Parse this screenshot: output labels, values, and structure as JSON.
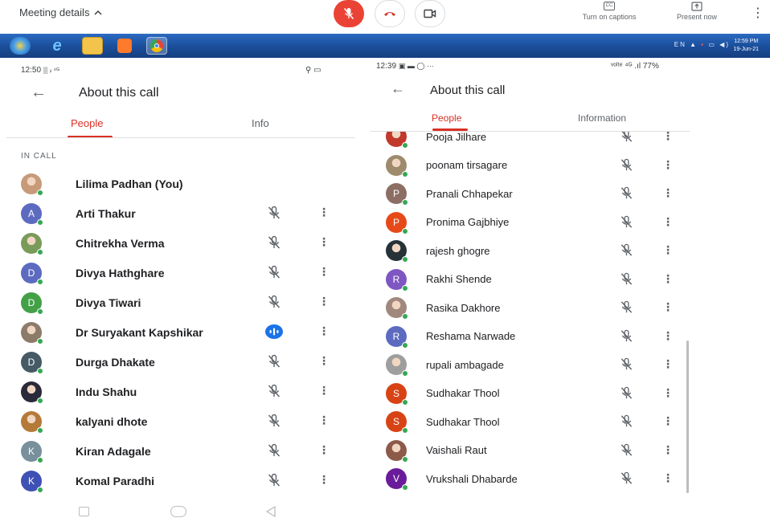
{
  "meet_bar": {
    "meeting_details": "Meeting details",
    "captions_label": "Turn on captions",
    "present_label": "Present now",
    "captions_icon_text": "CC"
  },
  "taskbar": {
    "lang": "EN",
    "time": "12:59 PM",
    "date": "19-Jun-21"
  },
  "left": {
    "status_time": "12:50",
    "status_icons": "▒ ᵢₗ ⁴ᴳ",
    "status_right": "⚲ ▭",
    "title": "About this call",
    "tabs": [
      "People",
      "Info"
    ],
    "section": "IN CALL",
    "people": [
      {
        "name": "Lilima Padhan (You)",
        "avatar": "photo",
        "color": "#c79a7a",
        "initial": "",
        "action": "none"
      },
      {
        "name": "Arti Thakur",
        "avatar": "letter",
        "color": "#5c6bc0",
        "initial": "A",
        "action": "muted"
      },
      {
        "name": "Chitrekha Verma",
        "avatar": "photo",
        "color": "#7a9a5a",
        "initial": "",
        "action": "muted"
      },
      {
        "name": "Divya Hathghare",
        "avatar": "letter",
        "color": "#5c6bc0",
        "initial": "D",
        "action": "muted"
      },
      {
        "name": "Divya Tiwari",
        "avatar": "letter",
        "color": "#43a047",
        "initial": "D",
        "action": "muted"
      },
      {
        "name": "Dr Suryakant Kapshikar",
        "avatar": "photo",
        "color": "#8d7b6a",
        "initial": "",
        "action": "speaking"
      },
      {
        "name": "Durga Dhakate",
        "avatar": "letter",
        "color": "#455a64",
        "initial": "D",
        "action": "muted"
      },
      {
        "name": "Indu Shahu",
        "avatar": "photo",
        "color": "#2a2a3a",
        "initial": "",
        "action": "muted"
      },
      {
        "name": "kalyani dhote",
        "avatar": "photo",
        "color": "#b57a3a",
        "initial": "",
        "action": "muted"
      },
      {
        "name": "Kiran Adagale",
        "avatar": "letter",
        "color": "#78909c",
        "initial": "K",
        "action": "muted"
      },
      {
        "name": "Komal Paradhi",
        "avatar": "letter",
        "color": "#3f51b5",
        "initial": "K",
        "action": "muted"
      }
    ]
  },
  "right": {
    "status_time": "12:39",
    "status_icons": "▣ ▬ ◯ ···",
    "status_right": "ᵛᵒˡᵗᵉ ⁴ᴳ .ıl 77%",
    "title": "About this call",
    "tabs": [
      "People",
      "Information"
    ],
    "people": [
      {
        "name": "Pooja Jilhare",
        "avatar": "photo",
        "color": "#c0392b",
        "initial": ""
      },
      {
        "name": "poonam tirsagare",
        "avatar": "photo",
        "color": "#9e8b6e",
        "initial": ""
      },
      {
        "name": "Pranali Chhapekar",
        "avatar": "letter",
        "color": "#8d6e63",
        "initial": "P"
      },
      {
        "name": "Pronima Gajbhiye",
        "avatar": "letter",
        "color": "#e64a19",
        "initial": "P"
      },
      {
        "name": "rajesh ghogre",
        "avatar": "photo",
        "color": "#263238",
        "initial": ""
      },
      {
        "name": "Rakhi Shende",
        "avatar": "letter",
        "color": "#7e57c2",
        "initial": "R"
      },
      {
        "name": "Rasika Dakhore",
        "avatar": "photo",
        "color": "#a1887f",
        "initial": ""
      },
      {
        "name": "Reshama Narwade",
        "avatar": "letter",
        "color": "#5c6bc0",
        "initial": "R"
      },
      {
        "name": "rupali ambagade",
        "avatar": "photo",
        "color": "#9e9e9e",
        "initial": ""
      },
      {
        "name": "Sudhakar Thool",
        "avatar": "letter",
        "color": "#d84315",
        "initial": "S"
      },
      {
        "name": "Sudhakar Thool",
        "avatar": "letter",
        "color": "#d84315",
        "initial": "S"
      },
      {
        "name": "Vaishali Raut",
        "avatar": "photo",
        "color": "#8d5a4a",
        "initial": ""
      },
      {
        "name": "Vrukshali Dhabarde",
        "avatar": "letter",
        "color": "#6a1b9a",
        "initial": "V"
      }
    ]
  },
  "colors": {
    "accent": "#d93025",
    "online": "#34a853",
    "speaking": "#1a73e8"
  }
}
